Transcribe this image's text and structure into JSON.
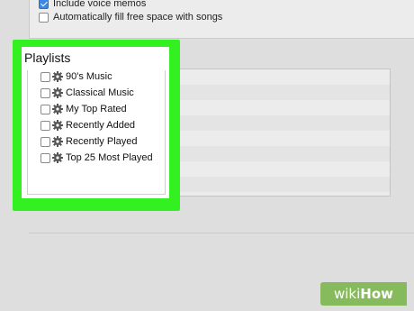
{
  "options": {
    "include_voice_memos": {
      "label": "Include voice memos",
      "checked": true
    },
    "auto_fill": {
      "label": "Automatically fill free space with songs",
      "checked": false
    }
  },
  "playlists": {
    "title": "Playlists",
    "items": [
      {
        "label": "90's Music",
        "checked": false,
        "icon": "gear-icon"
      },
      {
        "label": "Classical Music",
        "checked": false,
        "icon": "gear-icon"
      },
      {
        "label": "My Top Rated",
        "checked": false,
        "icon": "gear-icon"
      },
      {
        "label": "Recently Added",
        "checked": false,
        "icon": "gear-icon"
      },
      {
        "label": "Recently Played",
        "checked": false,
        "icon": "gear-icon"
      },
      {
        "label": "Top 25 Most Played",
        "checked": false,
        "icon": "gear-icon"
      }
    ]
  },
  "watermark": {
    "brand_a": "wiki",
    "brand_b": "How"
  },
  "colors": {
    "highlight": "#33f020",
    "checkbox_accent": "#3b88e8"
  }
}
